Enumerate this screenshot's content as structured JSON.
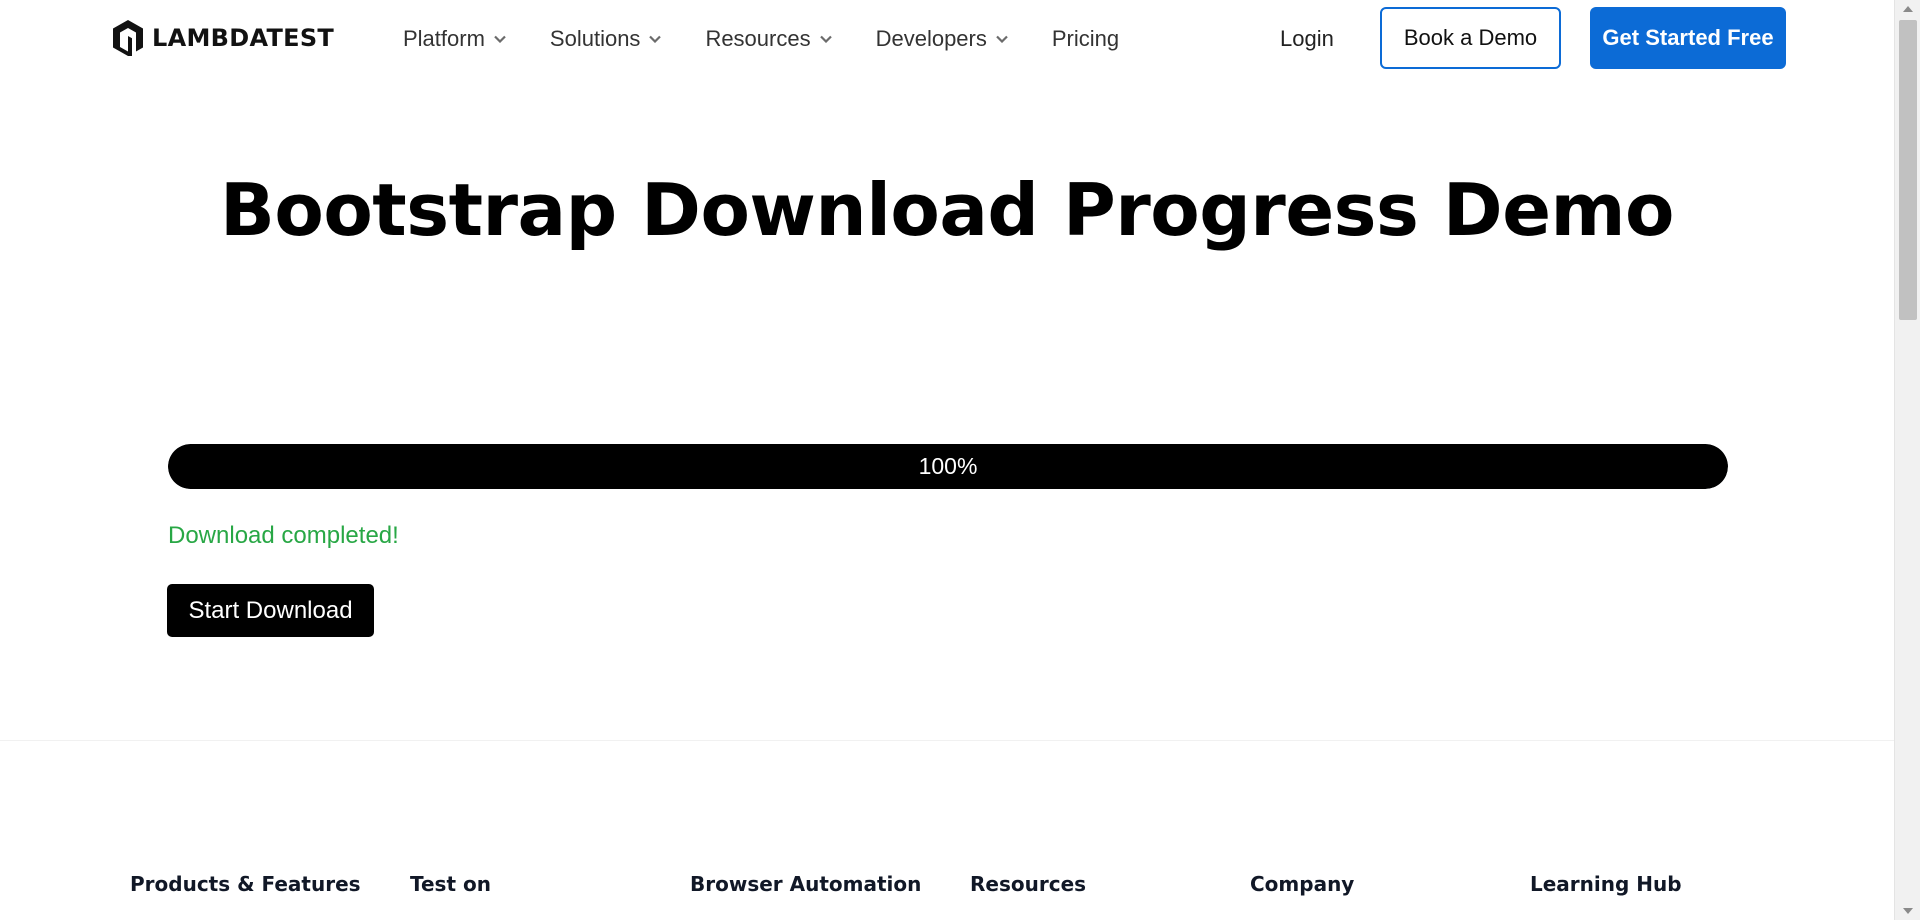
{
  "header": {
    "logo_text": "LAMBDATEST",
    "nav": [
      {
        "label": "Platform",
        "has_dropdown": true
      },
      {
        "label": "Solutions",
        "has_dropdown": true
      },
      {
        "label": "Resources",
        "has_dropdown": true
      },
      {
        "label": "Developers",
        "has_dropdown": true
      },
      {
        "label": "Pricing",
        "has_dropdown": false
      }
    ],
    "login_label": "Login",
    "book_demo_label": "Book a Demo",
    "get_started_label": "Get Started Free"
  },
  "main": {
    "title": "Bootstrap Download Progress Demo",
    "progress": {
      "value": 100,
      "label": "100%"
    },
    "status_text": "Download completed!",
    "start_button_label": "Start Download"
  },
  "footer": {
    "columns": [
      "Products & Features",
      "Test on",
      "Browser Automation",
      "Resources",
      "Company",
      "Learning Hub"
    ]
  },
  "colors": {
    "primary_blue": "#0c6bd6",
    "success_green": "#28a745",
    "progress_bar": "#000000",
    "text_dark": "#111111"
  },
  "icons": {
    "logo": "lambdatest-logo-icon",
    "dropdown": "chevron-down-icon"
  }
}
